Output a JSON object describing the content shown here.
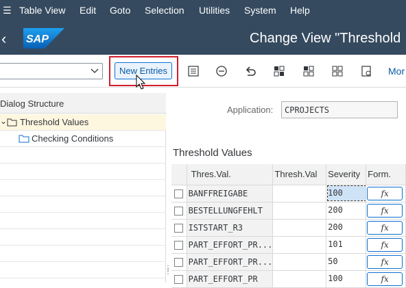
{
  "menu": [
    "Table View",
    "Edit",
    "Goto",
    "Selection",
    "Utilities",
    "System",
    "Help"
  ],
  "header": {
    "title": "Change View \"Threshold"
  },
  "toolbar": {
    "new_entries": "New Entries",
    "more": "Mor"
  },
  "dialog_structure": {
    "title": "Dialog Structure",
    "items": [
      {
        "label": "Threshold Values",
        "selected": true
      },
      {
        "label": "Checking Conditions",
        "selected": false
      }
    ]
  },
  "filter": {
    "label": "Application:",
    "value": "CPROJECTS"
  },
  "table": {
    "title": "Threshold Values",
    "headers": [
      "Thres.Val.",
      "Thresh.Val",
      "Severity",
      "Form."
    ],
    "rows": [
      {
        "name": "BANFFREIGABE",
        "thresh": "",
        "severity": "100",
        "formula": "fx"
      },
      {
        "name": "BESTELLUNGFEHLT",
        "thresh": "",
        "severity": "200",
        "formula": "fx"
      },
      {
        "name": "ISTSTART_R3",
        "thresh": "",
        "severity": "200",
        "formula": "fx"
      },
      {
        "name": "PART_EFFORT_PR...",
        "thresh": "",
        "severity": "101",
        "formula": "fx"
      },
      {
        "name": "PART_EFFORT_PR...",
        "thresh": "",
        "severity": "50",
        "formula": "fx"
      },
      {
        "name": "PART_EFFORT_PR",
        "thresh": "",
        "severity": "100",
        "formula": "fx"
      }
    ]
  }
}
